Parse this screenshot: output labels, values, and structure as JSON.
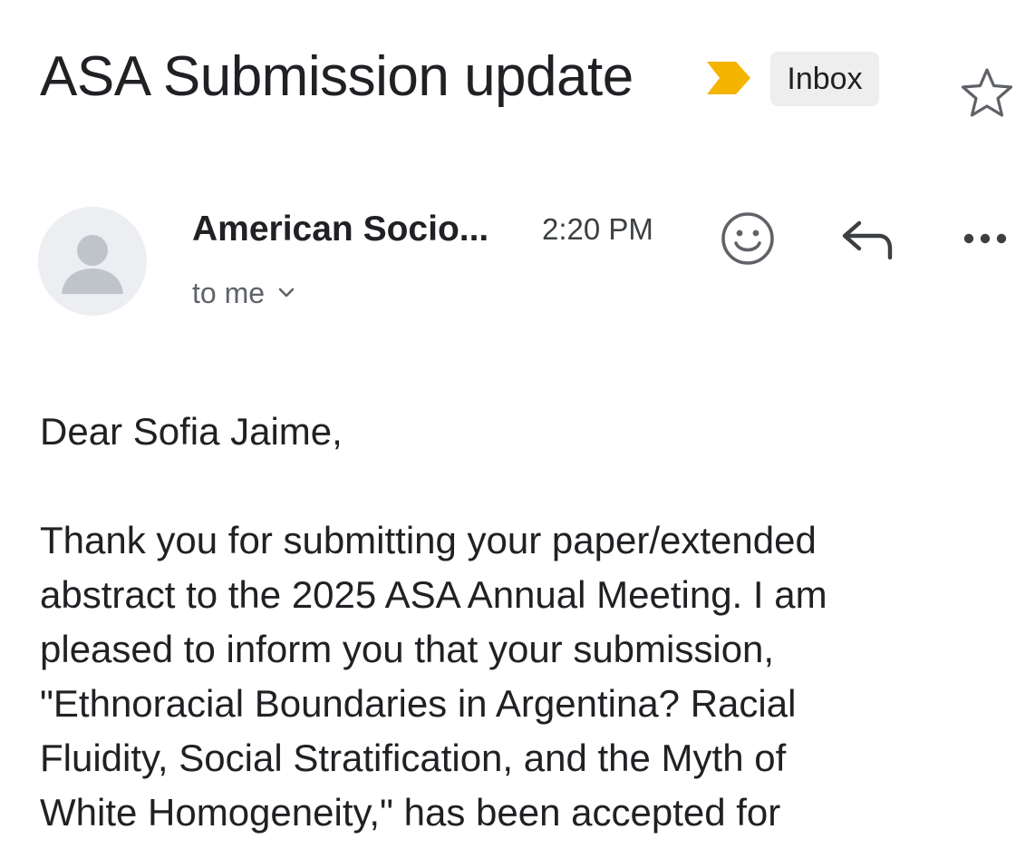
{
  "email": {
    "subject": "ASA Submission update",
    "label": "Inbox",
    "sender": "American Socio...",
    "time": "2:20 PM",
    "recipient": "to me",
    "greeting": "Dear Sofia Jaime,",
    "body_lines": [
      "Thank you for submitting your paper/extended",
      "abstract to the 2025 ASA Annual Meeting. I am",
      "pleased to inform you that your submission,",
      "\"Ethnoracial Boundaries in Argentina? Racial",
      "Fluidity, Social Stratification, and the Myth of",
      "White Homogeneity,\" has been accepted for"
    ]
  },
  "icons": {
    "importance": "importance-marker-icon",
    "star": "star-icon",
    "avatar": "person-avatar-icon",
    "recipient_expand": "chevron-down-icon",
    "emoji": "smiley-icon",
    "reply": "reply-icon",
    "more": "more-horizontal-icon"
  },
  "colors": {
    "importance": "#F4B400",
    "label_chip_bg": "#EEEEEE",
    "text": "#202124",
    "muted": "#5F6368"
  }
}
